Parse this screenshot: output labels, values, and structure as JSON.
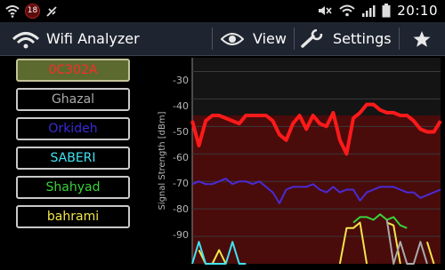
{
  "status_bar": {
    "notification_count": "18",
    "time": "20:10"
  },
  "action_bar": {
    "app_title": "Wifi Analyzer",
    "view_label": "View",
    "settings_label": "Settings"
  },
  "networks": [
    {
      "name": "0C302A",
      "color": "#ff2a2a",
      "selected": true
    },
    {
      "name": "Ghazal",
      "color": "#a9a9a9",
      "selected": false
    },
    {
      "name": "Orkideh",
      "color": "#3a2bd8",
      "selected": false
    },
    {
      "name": "SABERI",
      "color": "#3fe3f2",
      "selected": false
    },
    {
      "name": "Shahyad",
      "color": "#3ad23a",
      "selected": false
    },
    {
      "name": "bahrami",
      "color": "#f2e54a",
      "selected": false
    }
  ],
  "chart_data": {
    "type": "line",
    "ylabel": "Signal Strength [dBm]",
    "y_ticks": [
      "-30",
      "-40",
      "-50",
      "-60",
      "-70",
      "-80",
      "-90"
    ],
    "ylim": [
      -100,
      -25
    ],
    "plot_bg_above": "#141414",
    "plot_bg_below": "#4a0b0b",
    "series": [
      {
        "name": "0C302A",
        "color": "#ff1a1a",
        "values": [
          -48,
          -57,
          -48,
          -46,
          -46,
          -47,
          -48,
          -49,
          -46,
          -46,
          -46,
          -46,
          -48,
          -53,
          -55,
          -49,
          -46,
          -51,
          -46,
          -49,
          -50,
          -45,
          -55,
          -60,
          -47,
          -45,
          -42,
          -42,
          -44,
          -45,
          -45,
          -46,
          -46,
          -48,
          -51,
          -52,
          -52,
          -48
        ]
      },
      {
        "name": "Orkideh",
        "color": "#4a2bd6",
        "values": [
          -71,
          -70,
          -71,
          -71,
          -70,
          -69,
          -71,
          -70,
          -70,
          -71,
          -70,
          -72,
          -74,
          -78,
          -73,
          -72,
          -72,
          -72,
          -71,
          -73,
          -74,
          -72,
          -74,
          -73,
          -73,
          -77,
          -74,
          -73,
          -72,
          -72,
          -72,
          -73,
          -74,
          -74,
          -76,
          -75,
          -74,
          -73
        ]
      },
      {
        "name": "Shahyad",
        "color": "#3ad23a",
        "values": [
          null,
          null,
          null,
          null,
          null,
          null,
          null,
          null,
          null,
          null,
          null,
          null,
          null,
          null,
          null,
          null,
          null,
          null,
          null,
          null,
          null,
          null,
          null,
          null,
          -85,
          -83,
          -83,
          -84,
          -82,
          -84,
          -83,
          -86,
          -87,
          null,
          null,
          null,
          null,
          null
        ]
      },
      {
        "name": "bahrami",
        "color": "#f2e54a",
        "values": [
          null,
          -95,
          -101,
          -101,
          -95,
          -101,
          null,
          null,
          null,
          null,
          null,
          null,
          null,
          null,
          null,
          null,
          null,
          null,
          null,
          null,
          null,
          null,
          -101,
          -87,
          -87,
          -85,
          -101,
          null,
          null,
          -85,
          -86,
          -101,
          null,
          null,
          null,
          -92,
          -101,
          null
        ]
      },
      {
        "name": "SABERI",
        "color": "#3fe3f2",
        "values": [
          -101,
          -92,
          -101,
          -101,
          -101,
          -101,
          -92,
          -101,
          -101,
          null,
          null,
          null,
          null,
          null,
          null,
          null,
          null,
          null,
          null,
          null,
          null,
          null,
          null,
          null,
          null,
          null,
          null,
          null,
          null,
          null,
          null,
          null,
          null,
          null,
          null,
          null,
          null,
          null
        ]
      },
      {
        "name": "Ghazal",
        "color": "#a9a9a9",
        "values": [
          null,
          null,
          null,
          null,
          null,
          null,
          null,
          null,
          null,
          null,
          null,
          null,
          null,
          null,
          null,
          null,
          null,
          null,
          null,
          null,
          null,
          null,
          null,
          null,
          null,
          null,
          null,
          null,
          null,
          -84,
          -101,
          -92,
          -101,
          -101,
          -92,
          -101,
          null,
          null
        ]
      }
    ]
  }
}
